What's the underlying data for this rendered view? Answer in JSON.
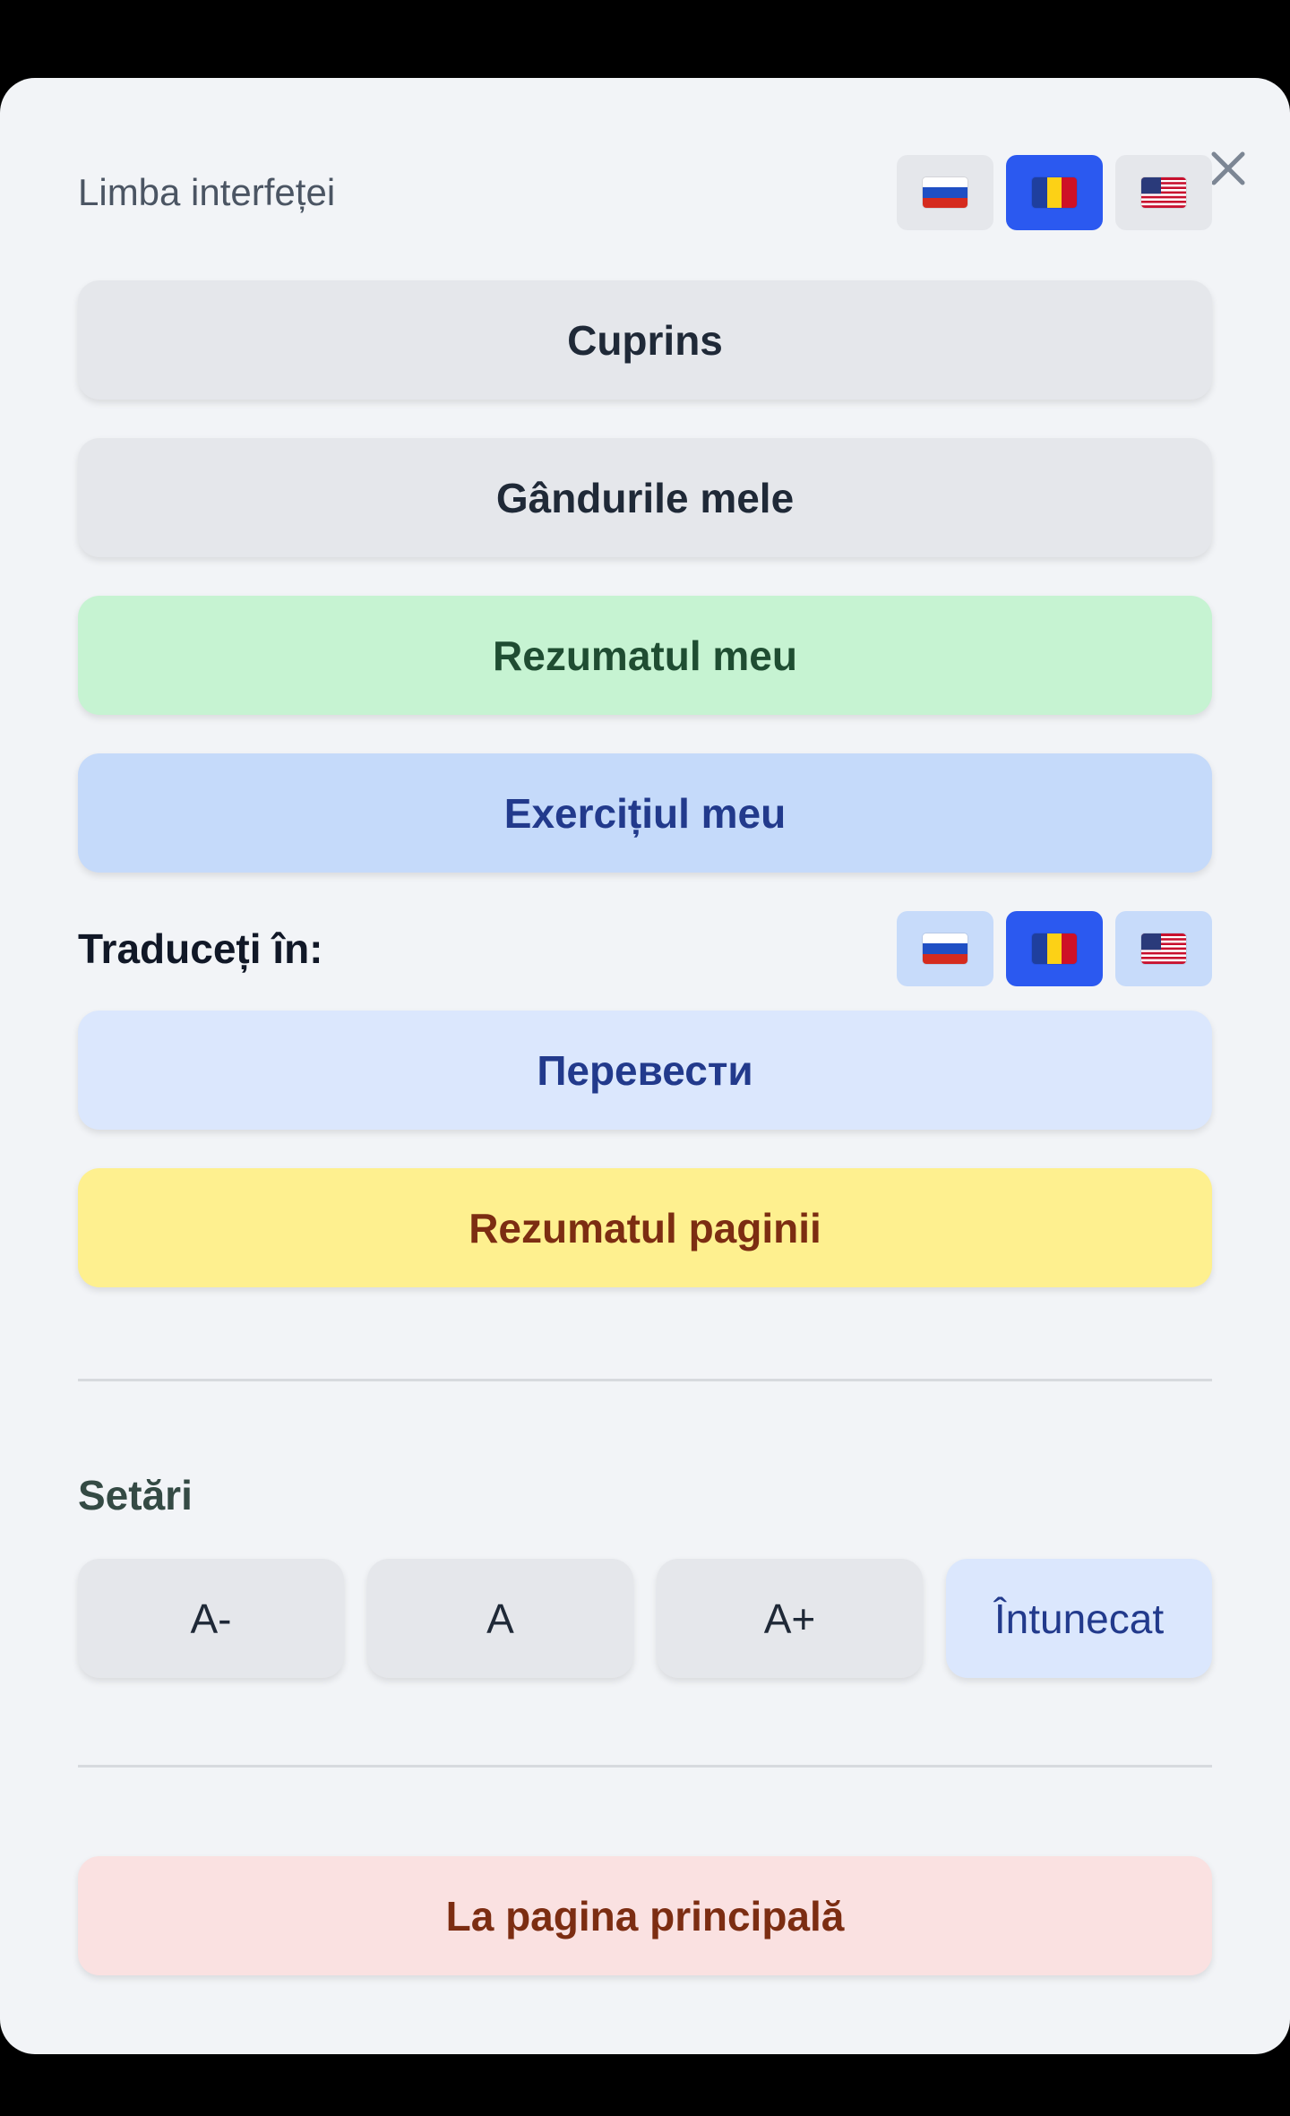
{
  "interface_language": {
    "label": "Limba interfeței",
    "flags": [
      {
        "country": "Russia",
        "icon": "flag-ru-icon"
      },
      {
        "country": "Romania",
        "icon": "flag-ro-icon",
        "selected": true
      },
      {
        "country": "United States",
        "icon": "flag-us-icon"
      }
    ]
  },
  "menu": {
    "contents": "Cuprins",
    "my_thoughts": "Gândurile mele",
    "my_summary": "Rezumatul meu",
    "my_exercise": "Exercițiul meu"
  },
  "translate": {
    "label": "Traduceți în:",
    "flags": [
      {
        "country": "Russia",
        "icon": "flag-ru-icon"
      },
      {
        "country": "Romania",
        "icon": "flag-ro-icon",
        "selected": true
      },
      {
        "country": "United States",
        "icon": "flag-us-icon"
      }
    ],
    "button": "Перевести"
  },
  "page_summary": "Rezumatul paginii",
  "settings": {
    "title": "Setări",
    "font_decrease": "A-",
    "font_default": "A",
    "font_increase": "A+",
    "dark_mode": "Întunecat"
  },
  "home_button": "La pagina principală",
  "colors": {
    "panel_bg": "#f2f4f7",
    "accent_blue": "#2b59f0",
    "green_button": "#c6f3d2",
    "blue_button": "#c5dafa",
    "yellow_button": "#fef08f",
    "red_button": "#fae1e1"
  }
}
